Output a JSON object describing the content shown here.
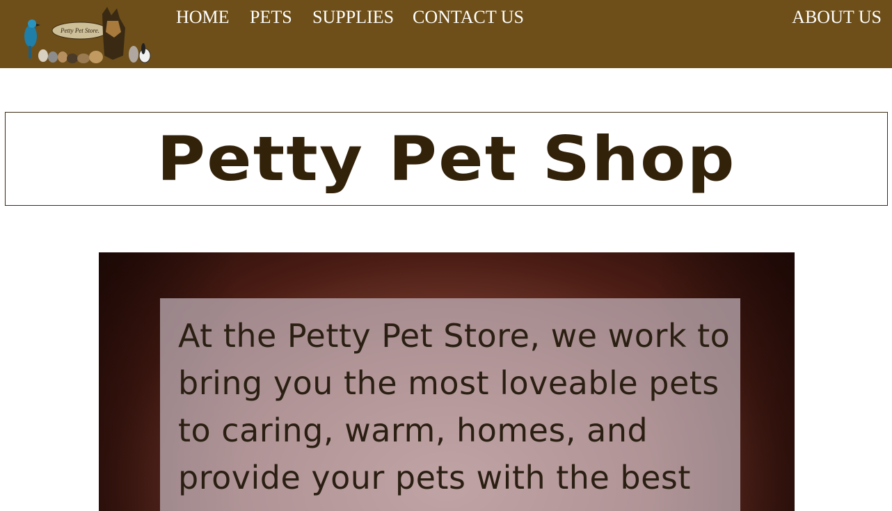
{
  "nav": {
    "logo_alt": "Petty Pet Store.",
    "links": [
      "HOME",
      "PETS",
      "SUPPLIES",
      "CONTACT US"
    ],
    "about": "ABOUT US"
  },
  "header": {
    "title": "Petty Pet Shop"
  },
  "hero": {
    "text": "At the Petty Pet Store, we work to bring you the most loveable pets to caring, warm, homes, and provide your pets with the best"
  },
  "colors": {
    "nav_bg": "#6e4f19",
    "title_color": "#33220a"
  }
}
